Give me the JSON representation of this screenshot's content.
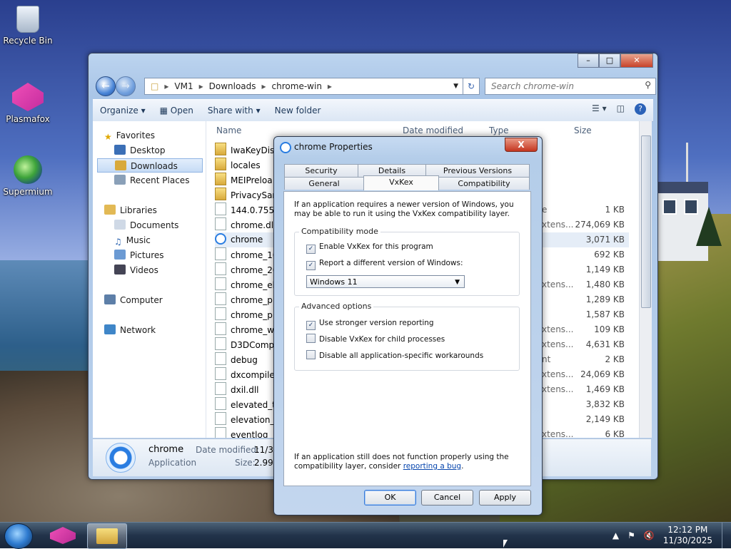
{
  "desktop": {
    "icons": [
      {
        "label": "Recycle Bin"
      },
      {
        "label": "Plasmafox"
      },
      {
        "label": "Supermium"
      }
    ]
  },
  "explorer": {
    "breadcrumb": [
      "VM1",
      "Downloads",
      "chrome-win"
    ],
    "search_placeholder": "Search chrome-win",
    "toolbar": {
      "organize": "Organize",
      "open": "Open",
      "share_with": "Share with",
      "new_folder": "New folder"
    },
    "nav": {
      "favorites": "Favorites",
      "desktop": "Desktop",
      "downloads": "Downloads",
      "recent_places": "Recent Places",
      "libraries": "Libraries",
      "documents": "Documents",
      "music": "Music",
      "pictures": "Pictures",
      "videos": "Videos",
      "computer": "Computer",
      "network": "Network"
    },
    "columns": {
      "name": "Name",
      "date_modified": "Date modified",
      "type": "Type",
      "size": "Size"
    },
    "files": [
      {
        "name": "IwaKeyDis",
        "type": "",
        "size": "",
        "icon": "folder"
      },
      {
        "name": "locales",
        "type": "",
        "size": "",
        "icon": "folder"
      },
      {
        "name": "MEIPreloa",
        "type": "",
        "size": "",
        "icon": "folder"
      },
      {
        "name": "PrivacySan",
        "type": "",
        "size": "",
        "icon": "folder"
      },
      {
        "name": "144.0.7557",
        "type": "e",
        "size": "1 KB",
        "icon": "file"
      },
      {
        "name": "chrome.dl",
        "type": "xtens...",
        "size": "274,069 KB",
        "icon": "dll"
      },
      {
        "name": "chrome",
        "type": "",
        "size": "3,071 KB",
        "icon": "app"
      },
      {
        "name": "chrome_10",
        "type": "",
        "size": "692 KB",
        "icon": "file"
      },
      {
        "name": "chrome_20",
        "type": "",
        "size": "1,149 KB",
        "icon": "file"
      },
      {
        "name": "chrome_el",
        "type": "xtens...",
        "size": "1,480 KB",
        "icon": "dll"
      },
      {
        "name": "chrome_p",
        "type": "",
        "size": "1,289 KB",
        "icon": "exe"
      },
      {
        "name": "chrome_p",
        "type": "",
        "size": "1,587 KB",
        "icon": "net"
      },
      {
        "name": "chrome_w",
        "type": "xtens...",
        "size": "109 KB",
        "icon": "dll"
      },
      {
        "name": "D3DComp",
        "type": "xtens...",
        "size": "4,631 KB",
        "icon": "dll"
      },
      {
        "name": "debug",
        "type": "nt",
        "size": "2 KB",
        "icon": "file"
      },
      {
        "name": "dxcompile",
        "type": "xtens...",
        "size": "24,069 KB",
        "icon": "dll"
      },
      {
        "name": "dxil.dll",
        "type": "xtens...",
        "size": "1,469 KB",
        "icon": "dll"
      },
      {
        "name": "elevated_t",
        "type": "",
        "size": "3,832 KB",
        "icon": "exe"
      },
      {
        "name": "elevation_",
        "type": "",
        "size": "2,149 KB",
        "icon": "exe"
      },
      {
        "name": "eventlog_",
        "type": "xtens...",
        "size": "6 KB",
        "icon": "dll"
      }
    ],
    "details": {
      "name": "chrome",
      "type": "Application",
      "date_label": "Date modified:",
      "date_value": "11/3(",
      "size_label": "Size:",
      "size_value": "2.99"
    }
  },
  "dialog": {
    "title": "chrome Properties",
    "close": "X",
    "tabs_back": [
      "Security",
      "Details",
      "Previous Versions"
    ],
    "tabs_front": [
      "General",
      "VxKex",
      "Compatibility"
    ],
    "active_tab": "VxKex",
    "intro": "If an application requires a newer version of Windows, you may be able to run it using the VxKex compatibility layer.",
    "compat_group": {
      "title": "Compatibility mode",
      "enable_label": "Enable VxKex for this program",
      "enable_checked": true,
      "report_label": "Report a different version of Windows:",
      "report_checked": true,
      "version_selected": "Windows 11"
    },
    "advanced_group": {
      "title": "Advanced options",
      "stronger_label": "Use stronger version reporting",
      "stronger_checked": true,
      "disable_child_label": "Disable VxKex for child processes",
      "disable_child_checked": false,
      "disable_workarounds_label": "Disable all application-specific workarounds",
      "disable_workarounds_checked": false
    },
    "footnote_text": "If an application still does not function properly using the compatibility layer, consider",
    "footnote_link": "reporting a bug",
    "footnote_end": ".",
    "buttons": {
      "ok": "OK",
      "cancel": "Cancel",
      "apply": "Apply"
    }
  },
  "taskbar": {
    "time": "12:12 PM",
    "date": "11/30/2025"
  }
}
